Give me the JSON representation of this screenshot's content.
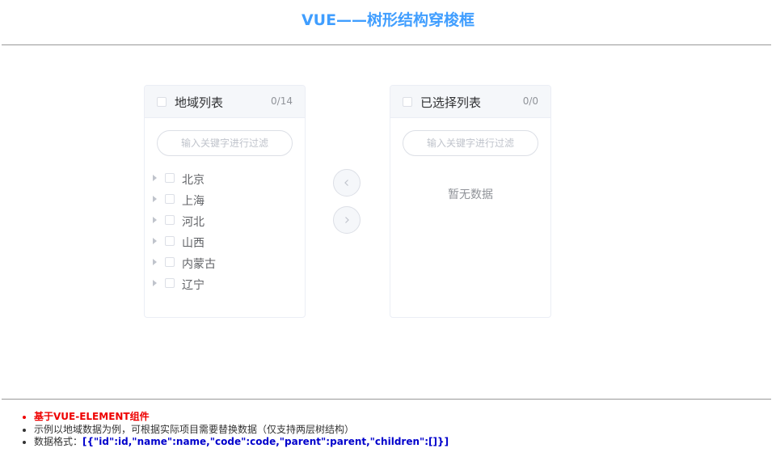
{
  "page": {
    "title": "VUE——树形结构穿梭框"
  },
  "left_panel": {
    "title": "地域列表",
    "count": "0/14",
    "filter_placeholder": "输入关键字进行过滤",
    "items": [
      "北京",
      "上海",
      "河北",
      "山西",
      "内蒙古",
      "辽宁"
    ]
  },
  "right_panel": {
    "title": "已选择列表",
    "count": "0/0",
    "filter_placeholder": "输入关键字进行过滤",
    "empty_text": "暂无数据"
  },
  "transfer_buttons": {
    "left_icon": "chevron-left-icon",
    "right_icon": "chevron-right-icon"
  },
  "notes": {
    "line1": "基于VUE-ELEMENT组件",
    "line2": "示例以地域数据为例，可根据实际项目需要替换数据（仅支持两层树结构）",
    "line3_label": "数据格式：",
    "line3_code": "[{\"id\":id,\"name\":name,\"code\":code,\"parent\":parent,\"children\":[]}]"
  },
  "colors": {
    "accent": "#409eff",
    "note_red": "#ee0000",
    "note_blue": "#0000cc"
  }
}
